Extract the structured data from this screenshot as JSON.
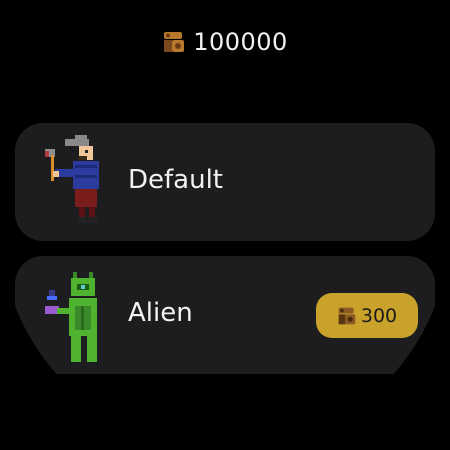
{
  "balance": {
    "value": "100000",
    "icon": "log-currency-icon"
  },
  "skins": [
    {
      "name": "Default",
      "icon": "lumberjack-character-icon",
      "owned": true
    },
    {
      "name": "Alien",
      "icon": "alien-character-icon",
      "price": "300",
      "price_icon": "log-currency-icon"
    }
  ],
  "colors": {
    "background": "#000000",
    "card": "#1d1d20",
    "badge": "#c8a22a",
    "text": "#f2f2f2"
  }
}
